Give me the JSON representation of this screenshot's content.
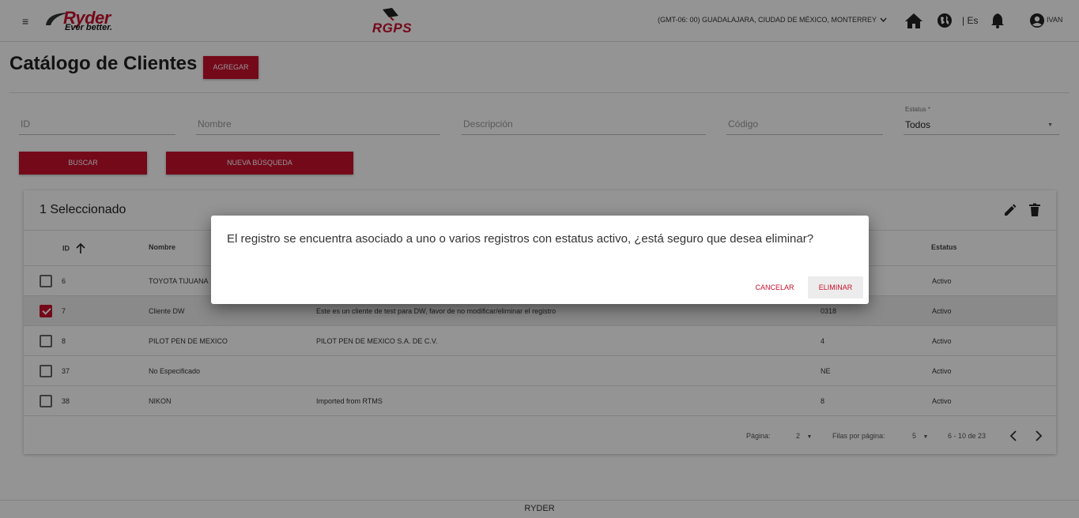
{
  "header": {
    "menu_glyph": "≡",
    "logo": {
      "brand": "Ryder",
      "tagline": "Ever better."
    },
    "app_logo": "RGPS",
    "timezone": "(GMT-06: 00) GUADALAJARA, CIUDAD DE MÉXICO, MONTERREY",
    "language": "| Es",
    "user": "IVAN"
  },
  "page": {
    "title": "Catálogo de Clientes",
    "add_label": "AGREGAR"
  },
  "filters": {
    "id_placeholder": "ID",
    "name_placeholder": "Nombre",
    "desc_placeholder": "Descripción",
    "code_placeholder": "Código",
    "status_label": "Estatus *",
    "status_value": "Todos",
    "search_label": "BUSCAR",
    "reset_label": "NUEVA BÚSQUEDA"
  },
  "table": {
    "selected_text": "1 Seleccionado",
    "headers": {
      "id": "ID",
      "name": "Nombre",
      "status": "Estatus"
    },
    "sort_glyph": "🡑",
    "rows": [
      {
        "id": "6",
        "name": "TOYOTA TIJUANA",
        "description": "",
        "code": "",
        "status": "Activo",
        "checked": false
      },
      {
        "id": "7",
        "name": "Cliente DW",
        "description": "Este es un cliente de test para DW, favor de no modificar/eliminar el registro",
        "code": "0318",
        "status": "Activo",
        "checked": true
      },
      {
        "id": "8",
        "name": "PILOT PEN DE MEXICO",
        "description": "PILOT PEN DE MEXICO S.A. DE C.V.",
        "code": "4",
        "status": "Activo",
        "checked": false
      },
      {
        "id": "37",
        "name": "No Especificado",
        "description": "",
        "code": "NE",
        "status": "Activo",
        "checked": false
      },
      {
        "id": "38",
        "name": "NIKON",
        "description": "Imported from RTMS",
        "code": "8",
        "status": "Activo",
        "checked": false
      }
    ],
    "pager": {
      "page_label": "Página:",
      "page_value": "2",
      "rows_label": "Filas por página:",
      "rows_value": "5",
      "range": "6 - 10 de 23"
    }
  },
  "footer": {
    "text": "RYDER"
  },
  "dialog": {
    "message": "El registro se encuentra asociado a uno o varios registros con estatus activo, ¿está seguro que desea eliminar?",
    "cancel_label": "CANCELAR",
    "delete_label": "ELIMINAR"
  },
  "colors": {
    "accent": "#c8102e",
    "overlay": "rgba(0,0,0,0.42)"
  },
  "icons": [
    "menu-icon",
    "home-icon",
    "globe-icon",
    "bell-icon",
    "account-icon",
    "edit-icon",
    "delete-icon",
    "sort-up-icon",
    "chevron-down-icon",
    "chevron-left-icon",
    "chevron-right-icon",
    "satellite-icon"
  ]
}
